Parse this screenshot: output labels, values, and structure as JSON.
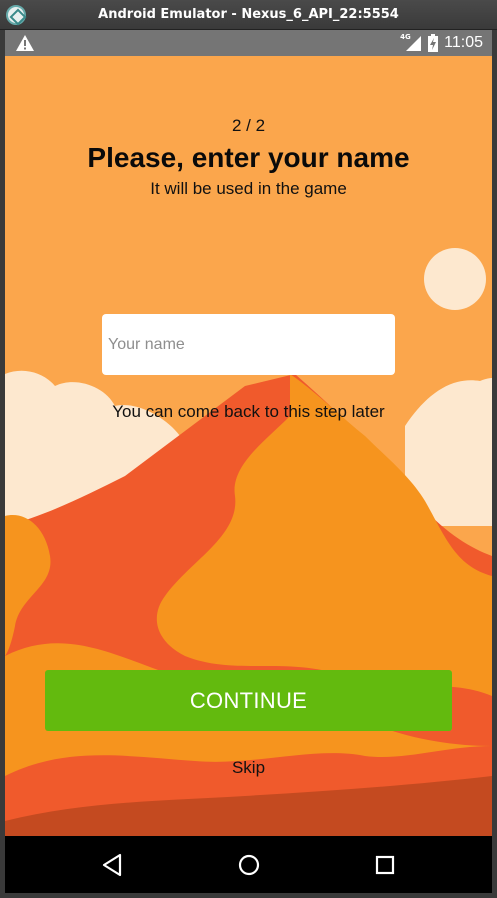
{
  "window": {
    "title": "Android Emulator - Nexus_6_API_22:5554"
  },
  "statusbar": {
    "network_label": "4G",
    "time": "11:05",
    "icons": [
      "warning-icon",
      "signal-icon",
      "battery-icon"
    ]
  },
  "onboarding": {
    "step": "2 / 2",
    "title": "Please, enter your name",
    "subtitle": "It will be used in the game",
    "name_input": {
      "value": "",
      "placeholder": "Your name"
    },
    "hint": "You can come back to this step later",
    "continue_label": "CONTINUE",
    "skip_label": "Skip"
  },
  "navbar": {
    "icons": [
      "back-icon",
      "home-icon",
      "recents-icon"
    ]
  },
  "colors": {
    "background": "#fba64c",
    "button": "#63ba0e",
    "mountain_red": "#f05a2c",
    "mountain_orange": "#f6941e",
    "sun": "#fde8cf"
  }
}
